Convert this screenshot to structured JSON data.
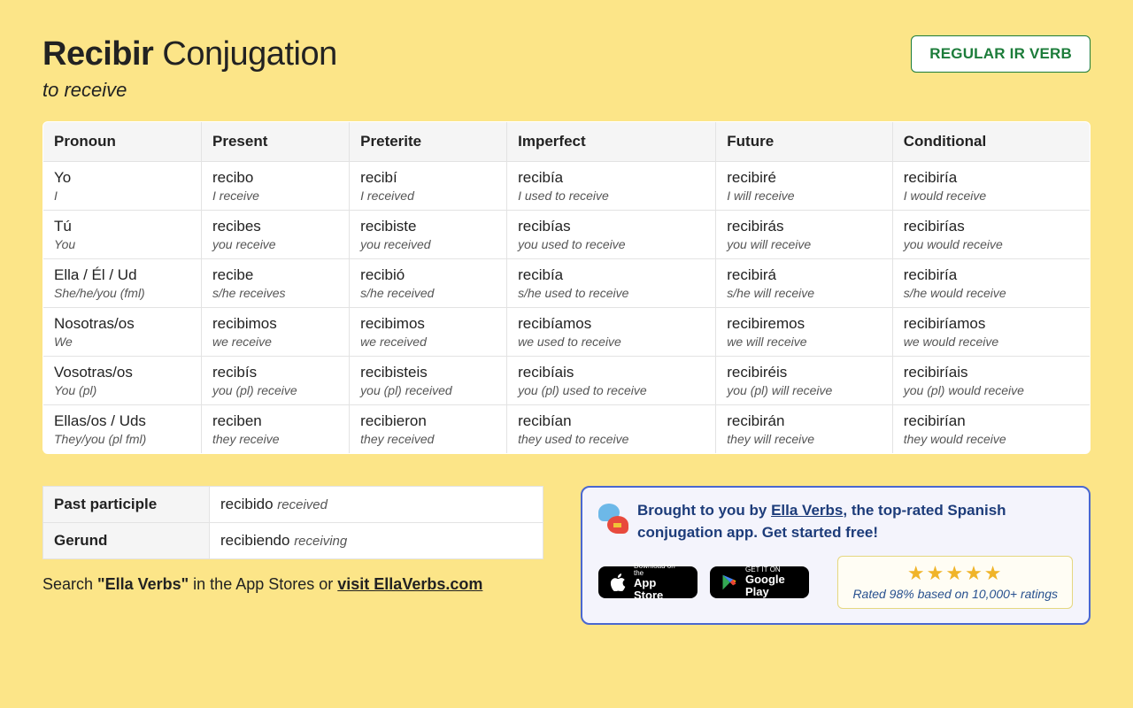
{
  "header": {
    "verb": "Recibir",
    "title_suffix": " Conjugation",
    "subtitle": "to receive",
    "badge": "REGULAR IR VERB"
  },
  "table": {
    "headers": [
      "Pronoun",
      "Present",
      "Preterite",
      "Imperfect",
      "Future",
      "Conditional"
    ],
    "rows": [
      {
        "pronoun": "Yo",
        "pronoun_gloss": "I",
        "cells": [
          {
            "w": "recibo",
            "g": "I receive"
          },
          {
            "w": "recibí",
            "g": "I received"
          },
          {
            "w": "recibía",
            "g": "I used to receive"
          },
          {
            "w": "recibiré",
            "g": "I will receive"
          },
          {
            "w": "recibiría",
            "g": "I would receive"
          }
        ]
      },
      {
        "pronoun": "Tú",
        "pronoun_gloss": "You",
        "cells": [
          {
            "w": "recibes",
            "g": "you receive"
          },
          {
            "w": "recibiste",
            "g": "you received"
          },
          {
            "w": "recibías",
            "g": "you used to receive"
          },
          {
            "w": "recibirás",
            "g": "you will receive"
          },
          {
            "w": "recibirías",
            "g": "you would receive"
          }
        ]
      },
      {
        "pronoun": "Ella / Él / Ud",
        "pronoun_gloss": "She/he/you (fml)",
        "cells": [
          {
            "w": "recibe",
            "g": "s/he receives"
          },
          {
            "w": "recibió",
            "g": "s/he received"
          },
          {
            "w": "recibía",
            "g": "s/he used to receive"
          },
          {
            "w": "recibirá",
            "g": "s/he will receive"
          },
          {
            "w": "recibiría",
            "g": "s/he would receive"
          }
        ]
      },
      {
        "pronoun": "Nosotras/os",
        "pronoun_gloss": "We",
        "cells": [
          {
            "w": "recibimos",
            "g": "we receive"
          },
          {
            "w": "recibimos",
            "g": "we received"
          },
          {
            "w": "recibíamos",
            "g": "we used to receive"
          },
          {
            "w": "recibiremos",
            "g": "we will receive"
          },
          {
            "w": "recibiríamos",
            "g": "we would receive"
          }
        ]
      },
      {
        "pronoun": "Vosotras/os",
        "pronoun_gloss": "You (pl)",
        "cells": [
          {
            "w": "recibís",
            "g": "you (pl) receive"
          },
          {
            "w": "recibisteis",
            "g": "you (pl) received"
          },
          {
            "w": "recibíais",
            "g": "you (pl) used to receive"
          },
          {
            "w": "recibiréis",
            "g": "you (pl) will receive"
          },
          {
            "w": "recibiríais",
            "g": "you (pl) would receive"
          }
        ]
      },
      {
        "pronoun": "Ellas/os / Uds",
        "pronoun_gloss": "They/you (pl fml)",
        "cells": [
          {
            "w": "reciben",
            "g": "they receive"
          },
          {
            "w": "recibieron",
            "g": "they received"
          },
          {
            "w": "recibían",
            "g": "they used to receive"
          },
          {
            "w": "recibirán",
            "g": "they will receive"
          },
          {
            "w": "recibirían",
            "g": "they would receive"
          }
        ]
      }
    ]
  },
  "participles": {
    "past_label": "Past participle",
    "past_word": "recibido",
    "past_gloss": "received",
    "gerund_label": "Gerund",
    "gerund_word": "recibiendo",
    "gerund_gloss": "receiving"
  },
  "search_line": {
    "prefix": "Search ",
    "bold": "\"Ella Verbs\"",
    "middle": " in the App Stores or ",
    "link": "visit EllaVerbs.com"
  },
  "promo": {
    "text_prefix": "Brought to you by ",
    "link": "Ella Verbs",
    "text_suffix": ", the top-rated Spanish conjugation app. Get started free!",
    "appstore_small": "Download on the",
    "appstore_large": "App Store",
    "play_small": "GET IT ON",
    "play_large": "Google Play",
    "rating_text": "Rated 98% based on 10,000+ ratings",
    "stars": "★★★★★"
  }
}
